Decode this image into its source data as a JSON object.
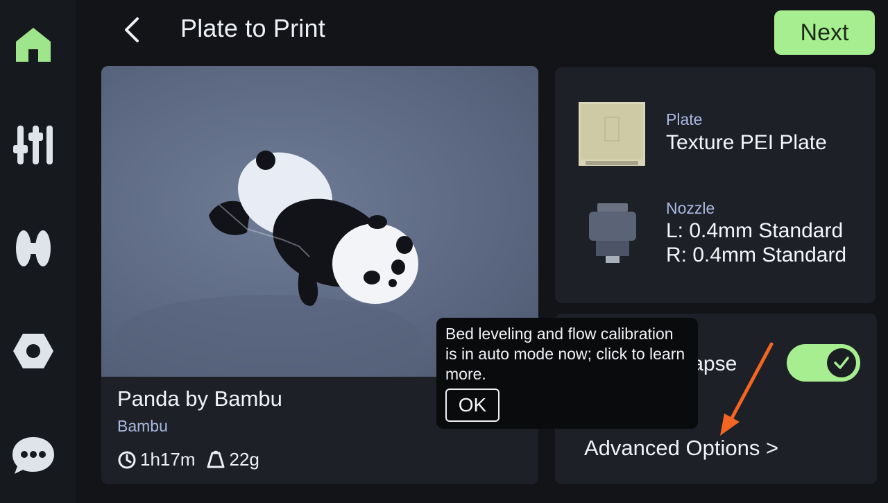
{
  "header": {
    "title": "Plate to Print",
    "next_label": "Next"
  },
  "sidebar": {
    "items": [
      {
        "icon": "home-icon",
        "active": true
      },
      {
        "icon": "controls-icon"
      },
      {
        "icon": "filament-icon"
      },
      {
        "icon": "settings-icon"
      },
      {
        "icon": "chat-icon"
      }
    ]
  },
  "model": {
    "name": "Panda by Bambu",
    "author": "Bambu",
    "time": "1h17m",
    "weight": "22g"
  },
  "plate": {
    "label": "Plate",
    "value": "Texture PEI Plate"
  },
  "nozzle": {
    "label": "Nozzle",
    "left": "L: 0.4mm Standard",
    "right": "R: 0.4mm Standard"
  },
  "options": {
    "timelapse_label": "TimeLapse",
    "timelapse_on": true,
    "advanced_label": "Advanced Options >"
  },
  "tooltip": {
    "text": "Bed leveling and flow calibration is in auto mode now; click to learn more.",
    "ok_label": "OK"
  },
  "colors": {
    "accent": "#a7ee91",
    "annotation_arrow": "#f26522"
  }
}
